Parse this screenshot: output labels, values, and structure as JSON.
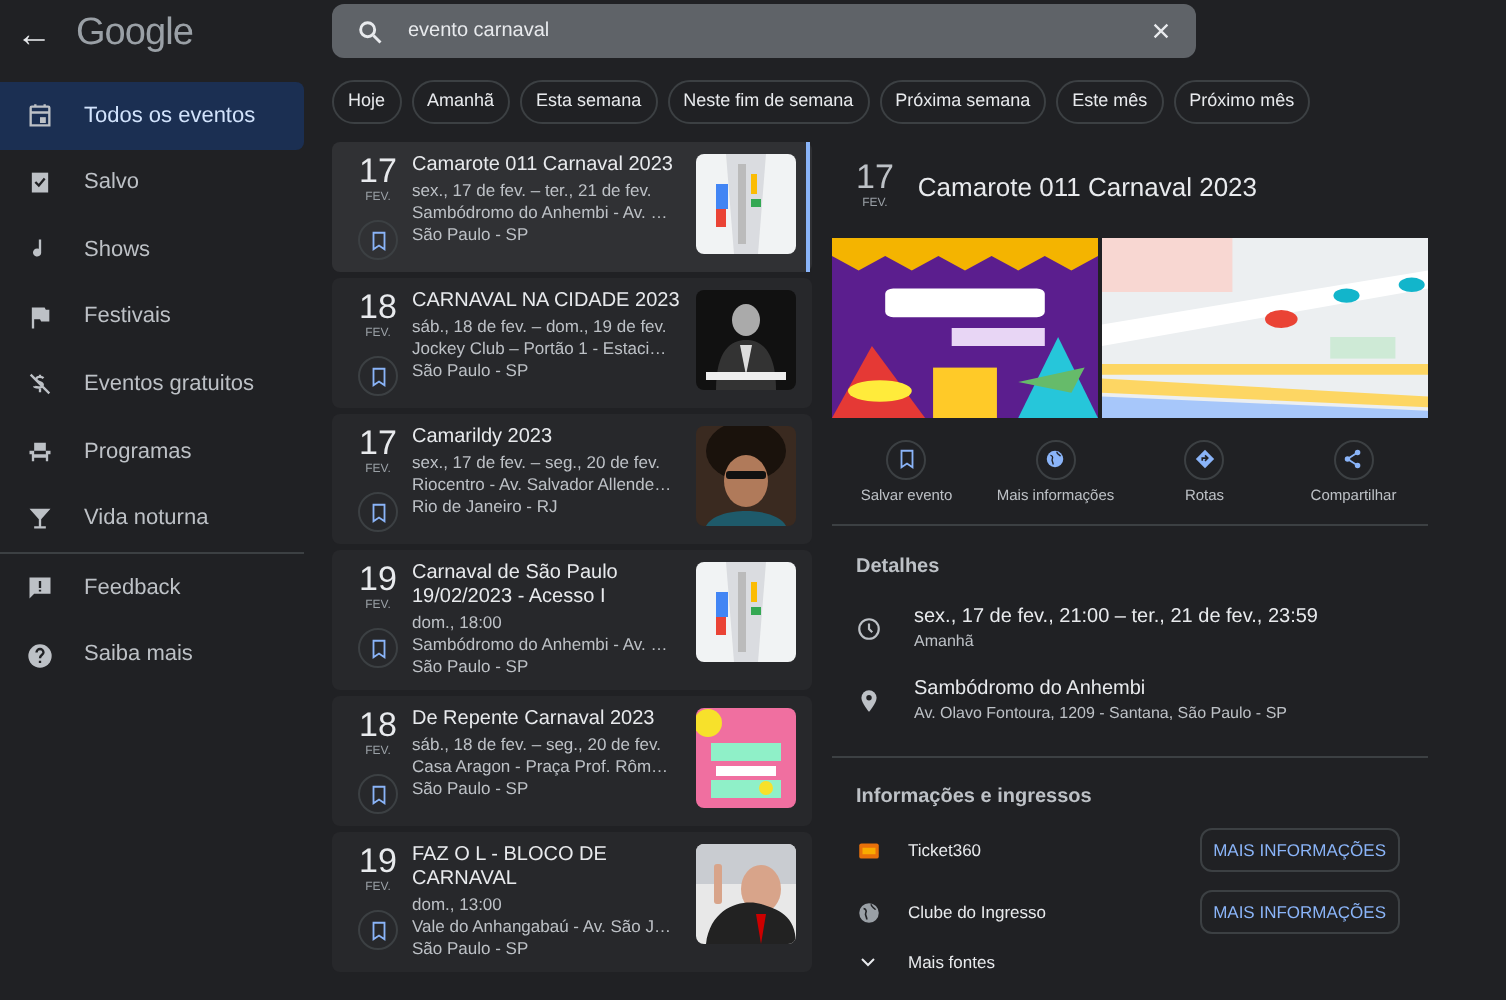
{
  "header": {
    "back": "←",
    "logo": "Google"
  },
  "search": {
    "value": "evento carnaval"
  },
  "sidebar": {
    "items": [
      {
        "label": "Todos os eventos",
        "selected": true
      },
      {
        "label": "Salvo",
        "selected": false
      },
      {
        "label": "Shows",
        "selected": false
      },
      {
        "label": "Festivais",
        "selected": false
      },
      {
        "label": "Eventos gratuitos",
        "selected": false
      },
      {
        "label": "Programas",
        "selected": false
      },
      {
        "label": "Vida noturna",
        "selected": false,
        "divider_after": true
      },
      {
        "label": "Feedback",
        "selected": false
      },
      {
        "label": "Saiba mais",
        "selected": false
      }
    ]
  },
  "chips": [
    {
      "label": "Hoje"
    },
    {
      "label": "Amanhã"
    },
    {
      "label": "Esta semana"
    },
    {
      "label": "Neste fim de semana"
    },
    {
      "label": "Próxima semana"
    },
    {
      "label": "Este mês"
    },
    {
      "label": "Próximo mês"
    }
  ],
  "events": [
    {
      "day": "17",
      "month": "FEV.",
      "title": "Camarote 011 Carnaval 2023",
      "lines": [
        "sex., 17 de fev. – ter., 21 de fev.",
        "Sambódromo do Anhembi - Av. …",
        "São Paulo - SP"
      ],
      "selected": true
    },
    {
      "day": "18",
      "month": "FEV.",
      "title": "CARNAVAL NA CIDADE 2023",
      "lines": [
        "sáb., 18 de fev. – dom., 19 de fev.",
        "Jockey Club – Portão 1 - Estaci…",
        "São Paulo - SP"
      ],
      "selected": false
    },
    {
      "day": "17",
      "month": "FEV.",
      "title": "Camarildy 2023",
      "lines": [
        "sex., 17 de fev. – seg., 20 de fev.",
        "Riocentro - Av. Salvador Allende…",
        "Rio de Janeiro - RJ"
      ],
      "selected": false
    },
    {
      "day": "19",
      "month": "FEV.",
      "title": "Carnaval de São Paulo 19/02/2023 - Acesso I",
      "lines": [
        "dom., 18:00",
        "Sambódromo do Anhembi - Av. …",
        "São Paulo - SP"
      ],
      "selected": false
    },
    {
      "day": "18",
      "month": "FEV.",
      "title": "De Repente Carnaval 2023",
      "lines": [
        "sáb., 18 de fev. – seg., 20 de fev.",
        "Casa Aragon - Praça Prof. Rôm…",
        "São Paulo - SP"
      ],
      "selected": false
    },
    {
      "day": "19",
      "month": "FEV.",
      "title": "FAZ O L - BLOCO DE CARNAVAL",
      "lines": [
        "dom., 13:00",
        "Vale do Anhangabaú - Av. São J…",
        "São Paulo - SP"
      ],
      "selected": false
    }
  ],
  "detail": {
    "day": "17",
    "month": "FEV.",
    "title": "Camarote 011 Carnaval 2023",
    "actions": [
      {
        "label": "Salvar evento"
      },
      {
        "label": "Mais informações"
      },
      {
        "label": "Rotas"
      },
      {
        "label": "Compartilhar"
      }
    ],
    "details_heading": "Detalhes",
    "when": {
      "text": "sex., 17 de fev., 21:00 – ter., 21 de fev., 23:59",
      "sub": "Amanhã"
    },
    "where": {
      "text": "Sambódromo do Anhembi",
      "sub": "Av. Olavo Fontoura, 1209 - Santana, São Paulo - SP"
    },
    "tickets_heading": "Informações e ingressos",
    "sources": [
      {
        "name": "Ticket360",
        "kind": "ticket",
        "button": "MAIS INFORMAÇÕES"
      },
      {
        "name": "Clube do Ingresso",
        "kind": "globe",
        "button": "MAIS INFORMAÇÕES"
      }
    ],
    "more": "Mais fontes"
  }
}
